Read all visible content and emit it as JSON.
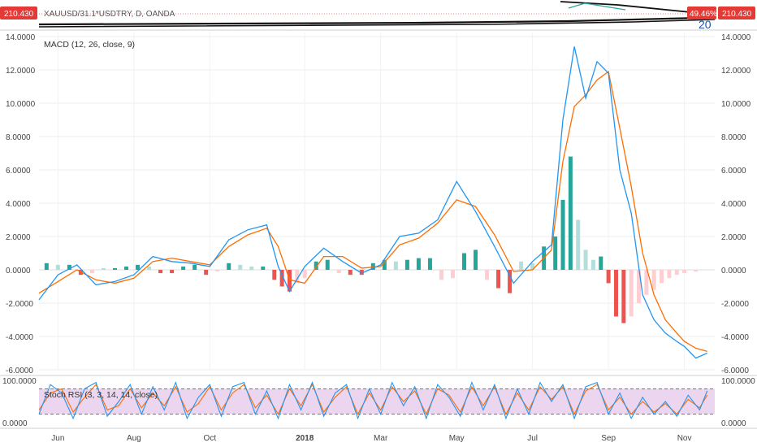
{
  "header": {
    "symbol": "XAUUSD/31.1*USDTRY, D, OANDA",
    "last_price": "210.430",
    "change_pct": "49.46%",
    "partial_value": "20",
    "badge_color": "#e53935"
  },
  "colors": {
    "macd_line": "#2196f3",
    "signal_line": "#ff6d00",
    "hist_up_strong": "#26a69a",
    "hist_up_weak": "#b2dfdb",
    "hist_down_strong": "#ef5350",
    "hist_down_weak": "#ffcdd2",
    "stoch_k": "#2196f3",
    "stoch_d": "#ff6d00",
    "stoch_band": "#e1bee7"
  },
  "chart_data": [
    {
      "type": "line",
      "indicator": "MACD",
      "title": "MACD (12, 26, close, 9)",
      "y_axis_ticks": [
        "14.0000",
        "12.0000",
        "10.0000",
        "8.0000",
        "6.0000",
        "4.0000",
        "2.0000",
        "0.0000",
        "-2.0000",
        "-4.0000",
        "-6.0000"
      ],
      "ylim": [
        -6,
        14
      ],
      "x_axis_labels": [
        "Jun",
        "Aug",
        "Oct",
        "2018",
        "Mar",
        "May",
        "Jul",
        "Sep",
        "Nov"
      ],
      "x_axis_positions": [
        0.5,
        2.5,
        4.5,
        7.0,
        9.0,
        11.0,
        13.0,
        15.0,
        17.0
      ],
      "x_range": [
        0,
        17.8
      ],
      "series": [
        {
          "role": "macd",
          "x": [
            0,
            0.5,
            1.0,
            1.5,
            2.0,
            2.5,
            3.0,
            3.5,
            4.0,
            4.5,
            5.0,
            5.5,
            6.0,
            6.3,
            6.6,
            7.0,
            7.5,
            8.0,
            8.5,
            9.0,
            9.5,
            10.0,
            10.5,
            11.0,
            11.5,
            12.0,
            12.5,
            13.0,
            13.5,
            13.8,
            14.1,
            14.4,
            14.7,
            15.0,
            15.3,
            15.6,
            15.9,
            16.2,
            16.5,
            16.8,
            17.0,
            17.3,
            17.6
          ],
          "values": [
            -1.8,
            -0.3,
            0.3,
            -0.9,
            -0.7,
            -0.3,
            0.8,
            0.5,
            0.4,
            0.2,
            1.8,
            2.4,
            2.7,
            0.2,
            -1.3,
            0.2,
            1.3,
            0.5,
            -0.2,
            0.3,
            2.0,
            2.2,
            3.0,
            5.3,
            3.5,
            1.4,
            -0.8,
            0.5,
            1.5,
            9.0,
            13.4,
            10.3,
            12.5,
            11.8,
            6.0,
            3.4,
            -1.5,
            -3.0,
            -3.8,
            -4.3,
            -4.6,
            -5.3,
            -5.0
          ]
        },
        {
          "role": "signal",
          "x": [
            0,
            0.5,
            1.0,
            1.5,
            2.0,
            2.5,
            3.0,
            3.5,
            4.0,
            4.5,
            5.0,
            5.5,
            6.0,
            6.3,
            6.6,
            7.0,
            7.5,
            8.0,
            8.5,
            9.0,
            9.5,
            10.0,
            10.5,
            11.0,
            11.5,
            12.0,
            12.5,
            13.0,
            13.5,
            13.8,
            14.1,
            14.4,
            14.7,
            15.0,
            15.3,
            15.6,
            15.9,
            16.2,
            16.5,
            16.8,
            17.0,
            17.3,
            17.6
          ],
          "values": [
            -1.4,
            -0.7,
            0.0,
            -0.6,
            -0.8,
            -0.5,
            0.5,
            0.7,
            0.5,
            0.3,
            1.4,
            2.1,
            2.5,
            1.4,
            -0.6,
            -0.8,
            0.8,
            0.8,
            0.1,
            0.2,
            1.5,
            1.9,
            2.8,
            4.2,
            3.8,
            2.1,
            -0.1,
            0.0,
            1.2,
            6.5,
            9.8,
            10.5,
            11.4,
            11.9,
            8.5,
            5.0,
            1.0,
            -1.5,
            -3.0,
            -3.8,
            -4.3,
            -4.7,
            -4.9
          ]
        },
        {
          "role": "histogram",
          "x": [
            0.2,
            0.5,
            0.8,
            1.1,
            1.4,
            1.7,
            2.0,
            2.3,
            2.6,
            2.9,
            3.2,
            3.5,
            3.8,
            4.1,
            4.4,
            4.7,
            5.0,
            5.3,
            5.6,
            5.9,
            6.2,
            6.4,
            6.6,
            6.8,
            7.0,
            7.3,
            7.6,
            7.9,
            8.2,
            8.5,
            8.8,
            9.1,
            9.4,
            9.7,
            10.0,
            10.3,
            10.6,
            10.9,
            11.2,
            11.5,
            11.8,
            12.1,
            12.4,
            12.7,
            13.0,
            13.3,
            13.6,
            13.8,
            14.0,
            14.2,
            14.4,
            14.6,
            14.8,
            15.0,
            15.2,
            15.4,
            15.6,
            15.8,
            16.0,
            16.2,
            16.4,
            16.6,
            16.8,
            17.0,
            17.3
          ],
          "values": [
            0.4,
            0.3,
            0.3,
            -0.3,
            -0.2,
            0.1,
            0.1,
            0.2,
            0.3,
            0.2,
            -0.2,
            -0.2,
            0.2,
            0.3,
            -0.3,
            -0.1,
            0.4,
            0.3,
            0.2,
            0.2,
            -0.6,
            -1.0,
            -1.3,
            -0.8,
            -0.5,
            0.5,
            0.6,
            -0.2,
            -0.3,
            -0.3,
            0.4,
            0.6,
            0.5,
            0.6,
            0.7,
            0.7,
            -0.6,
            -0.5,
            1.0,
            1.2,
            -0.6,
            -1.1,
            -1.4,
            0.5,
            0.4,
            1.4,
            2.0,
            4.2,
            6.8,
            3.0,
            1.2,
            0.6,
            0.8,
            -0.8,
            -2.8,
            -3.2,
            -2.8,
            -2.0,
            -1.5,
            -1.2,
            -0.8,
            -0.5,
            -0.3,
            -0.2,
            -0.1
          ]
        }
      ]
    },
    {
      "type": "line",
      "indicator": "Stoch RSI",
      "title": "Stoch RSI (3, 3, 14, 14, close)",
      "y_axis_ticks": [
        "100.0000",
        "0.0000"
      ],
      "ylim": [
        0,
        100
      ],
      "bands": [
        20,
        80
      ],
      "x_range": [
        0,
        17.8
      ],
      "series": [
        {
          "role": "k",
          "x": [
            0,
            0.3,
            0.6,
            0.9,
            1.2,
            1.5,
            1.8,
            2.1,
            2.4,
            2.7,
            3.0,
            3.3,
            3.6,
            3.9,
            4.2,
            4.5,
            4.8,
            5.1,
            5.4,
            5.7,
            6.0,
            6.3,
            6.6,
            6.9,
            7.2,
            7.5,
            7.8,
            8.1,
            8.4,
            8.7,
            9.0,
            9.3,
            9.6,
            9.9,
            10.2,
            10.5,
            10.8,
            11.1,
            11.4,
            11.7,
            12.0,
            12.3,
            12.6,
            12.9,
            13.2,
            13.5,
            13.8,
            14.1,
            14.4,
            14.7,
            15.0,
            15.3,
            15.6,
            15.9,
            16.2,
            16.5,
            16.8,
            17.1,
            17.4,
            17.6
          ],
          "values": [
            20,
            90,
            70,
            10,
            80,
            95,
            15,
            50,
            90,
            20,
            85,
            30,
            95,
            10,
            60,
            90,
            15,
            85,
            95,
            20,
            75,
            10,
            90,
            30,
            95,
            15,
            70,
            90,
            10,
            80,
            20,
            95,
            40,
            85,
            10,
            90,
            60,
            15,
            95,
            30,
            90,
            10,
            80,
            20,
            95,
            50,
            90,
            10,
            85,
            95,
            20,
            70,
            10,
            60,
            20,
            50,
            15,
            65,
            30,
            75
          ]
        },
        {
          "role": "d",
          "x": [
            0,
            0.3,
            0.6,
            0.9,
            1.2,
            1.5,
            1.8,
            2.1,
            2.4,
            2.7,
            3.0,
            3.3,
            3.6,
            3.9,
            4.2,
            4.5,
            4.8,
            5.1,
            5.4,
            5.7,
            6.0,
            6.3,
            6.6,
            6.9,
            7.2,
            7.5,
            7.8,
            8.1,
            8.4,
            8.7,
            9.0,
            9.3,
            9.6,
            9.9,
            10.2,
            10.5,
            10.8,
            11.1,
            11.4,
            11.7,
            12.0,
            12.3,
            12.6,
            12.9,
            13.2,
            13.5,
            13.8,
            14.1,
            14.4,
            14.7,
            15.0,
            15.3,
            15.6,
            15.9,
            16.2,
            16.5,
            16.8,
            17.1,
            17.4,
            17.6
          ],
          "values": [
            30,
            70,
            80,
            25,
            60,
            90,
            30,
            40,
            80,
            35,
            70,
            40,
            85,
            25,
            45,
            85,
            30,
            70,
            90,
            35,
            65,
            20,
            80,
            40,
            90,
            25,
            60,
            85,
            20,
            70,
            30,
            85,
            50,
            75,
            20,
            80,
            65,
            25,
            85,
            40,
            85,
            20,
            70,
            30,
            85,
            55,
            85,
            20,
            75,
            90,
            30,
            60,
            20,
            50,
            25,
            45,
            20,
            55,
            35,
            65
          ]
        }
      ]
    }
  ]
}
